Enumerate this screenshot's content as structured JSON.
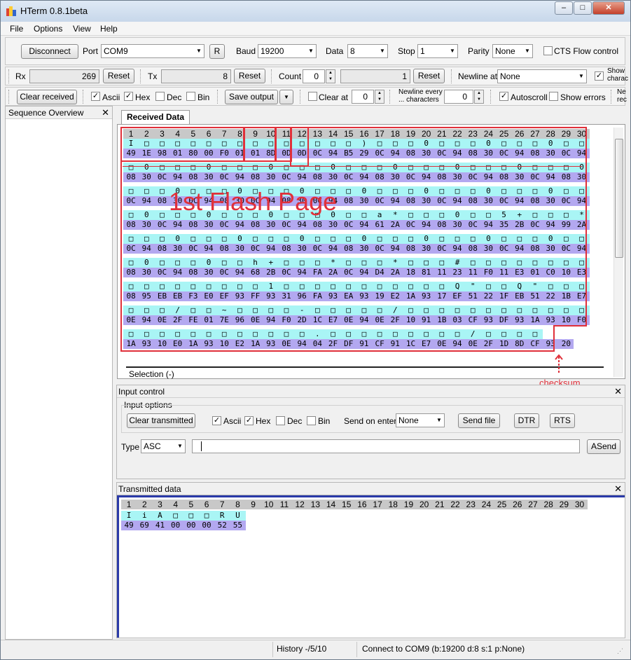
{
  "window": {
    "title": "HTerm 0.8.1beta",
    "min": "‒",
    "max": "□",
    "close": "✕"
  },
  "menu": [
    "File",
    "Options",
    "View",
    "Help"
  ],
  "conn": {
    "disconnect": "Disconnect",
    "port_label": "Port",
    "port": "COM9",
    "r_btn": "R",
    "baud_label": "Baud",
    "baud": "19200",
    "data_label": "Data",
    "data": "8",
    "stop_label": "Stop",
    "stop": "1",
    "parity_label": "Parity",
    "parity": "None",
    "cts": "CTS Flow control"
  },
  "counters": {
    "rx_label": "Rx",
    "rx": "269",
    "reset": "Reset",
    "tx_label": "Tx",
    "tx": "8",
    "count_label": "Count",
    "count": "0",
    "count_val": "1",
    "newline_label": "Newline at",
    "newline": "None",
    "show_ctrl": "Show\ncharac"
  },
  "opts": {
    "clear_received": "Clear received",
    "ascii": "Ascii",
    "hex": "Hex",
    "dec": "Dec",
    "bin": "Bin",
    "save_output": "Save output",
    "clear_at": "Clear at",
    "clear_at_val": "0",
    "newline_every": "Newline every\n... characters",
    "newline_every_val": "0",
    "autoscroll": "Autoscroll",
    "show_errors": "Show errors",
    "newline_rec": "Ne\nrec"
  },
  "sequence_overview": "Sequence Overview",
  "received_tab": "Received Data",
  "columns": [
    "1",
    "2",
    "3",
    "4",
    "5",
    "6",
    "7",
    "8",
    "9",
    "10",
    "11",
    "12",
    "13",
    "14",
    "15",
    "16",
    "17",
    "18",
    "19",
    "20",
    "21",
    "22",
    "23",
    "24",
    "25",
    "26",
    "27",
    "28",
    "29",
    "30"
  ],
  "rx_rows": [
    {
      "asc": [
        "I",
        "□",
        "□",
        "□",
        "□",
        "□",
        "□",
        "□",
        "□",
        "□",
        "□",
        "□",
        "□",
        "□",
        "□",
        ")",
        "□",
        "□",
        "□",
        "0",
        "□",
        "□",
        "□",
        "0",
        "□",
        "□",
        "□",
        "0",
        "□",
        "□"
      ],
      "hex": [
        "49",
        "1E",
        "98",
        "01",
        "80",
        "00",
        "F0",
        "01",
        "01",
        "8D",
        "0D",
        "0D",
        "0C",
        "94",
        "B5",
        "29",
        "0C",
        "94",
        "08",
        "30",
        "0C",
        "94",
        "08",
        "30",
        "0C",
        "94",
        "08",
        "30",
        "0C",
        "94"
      ]
    },
    {
      "asc": [
        "□",
        "0",
        "□",
        "□",
        "□",
        "0",
        "□",
        "□",
        "□",
        "0",
        "□",
        "□",
        "□",
        "0",
        "□",
        "□",
        "□",
        "0",
        "□",
        "□",
        "□",
        "0",
        "□",
        "□",
        "□",
        "0",
        "□",
        "□",
        "□",
        "0"
      ],
      "hex": [
        "08",
        "30",
        "0C",
        "94",
        "08",
        "30",
        "0C",
        "94",
        "08",
        "30",
        "0C",
        "94",
        "08",
        "30",
        "0C",
        "94",
        "08",
        "30",
        "0C",
        "94",
        "08",
        "30",
        "0C",
        "94",
        "08",
        "30",
        "0C",
        "94",
        "08",
        "30"
      ]
    },
    {
      "asc": [
        "□",
        "□",
        "□",
        "0",
        "□",
        "□",
        "□",
        "0",
        "□",
        "□",
        "□",
        "0",
        "□",
        "□",
        "□",
        "0",
        "□",
        "□",
        "□",
        "0",
        "□",
        "□",
        "□",
        "0",
        "□",
        "□",
        "□",
        "0",
        "□",
        "□"
      ],
      "hex": [
        "0C",
        "94",
        "08",
        "30",
        "0C",
        "94",
        "08",
        "30",
        "0C",
        "94",
        "08",
        "30",
        "0C",
        "94",
        "08",
        "30",
        "0C",
        "94",
        "08",
        "30",
        "0C",
        "94",
        "08",
        "30",
        "0C",
        "94",
        "08",
        "30",
        "0C",
        "94"
      ]
    },
    {
      "asc": [
        "□",
        "0",
        "□",
        "□",
        "□",
        "0",
        "□",
        "□",
        "□",
        "0",
        "□",
        "□",
        "□",
        "0",
        "□",
        "□",
        "a",
        "*",
        "□",
        "□",
        "□",
        "0",
        "□",
        "□",
        "5",
        "+",
        "□",
        "□",
        "□",
        "*"
      ],
      "hex": [
        "08",
        "30",
        "0C",
        "94",
        "08",
        "30",
        "0C",
        "94",
        "08",
        "30",
        "0C",
        "94",
        "08",
        "30",
        "0C",
        "94",
        "61",
        "2A",
        "0C",
        "94",
        "08",
        "30",
        "0C",
        "94",
        "35",
        "2B",
        "0C",
        "94",
        "99",
        "2A"
      ]
    },
    {
      "asc": [
        "□",
        "□",
        "□",
        "0",
        "□",
        "□",
        "□",
        "0",
        "□",
        "□",
        "□",
        "0",
        "□",
        "□",
        "□",
        "0",
        "□",
        "□",
        "□",
        "0",
        "□",
        "□",
        "□",
        "0",
        "□",
        "□",
        "□",
        "0",
        "□",
        "□"
      ],
      "hex": [
        "0C",
        "94",
        "08",
        "30",
        "0C",
        "94",
        "08",
        "30",
        "0C",
        "94",
        "08",
        "30",
        "0C",
        "94",
        "08",
        "30",
        "0C",
        "94",
        "08",
        "30",
        "0C",
        "94",
        "08",
        "30",
        "0C",
        "94",
        "08",
        "30",
        "0C",
        "94"
      ]
    },
    {
      "asc": [
        "□",
        "0",
        "□",
        "□",
        "□",
        "0",
        "□",
        "□",
        "h",
        "+",
        "□",
        "□",
        "□",
        "*",
        "□",
        "□",
        "□",
        "*",
        "□",
        "□",
        "□",
        "#",
        "□",
        "□",
        "□",
        "□",
        "□",
        "□",
        "□",
        "□"
      ],
      "hex": [
        "08",
        "30",
        "0C",
        "94",
        "08",
        "30",
        "0C",
        "94",
        "68",
        "2B",
        "0C",
        "94",
        "FA",
        "2A",
        "0C",
        "94",
        "D4",
        "2A",
        "18",
        "81",
        "11",
        "23",
        "11",
        "F0",
        "11",
        "E3",
        "01",
        "C0",
        "10",
        "E3"
      ]
    },
    {
      "asc": [
        "□",
        "□",
        "□",
        "□",
        "□",
        "□",
        "□",
        "□",
        "□",
        "1",
        "□",
        "□",
        "□",
        "□",
        "□",
        "□",
        "□",
        "□",
        "□",
        "□",
        "□",
        "Q",
        "\"",
        "□",
        "□",
        "Q",
        "\"",
        "□",
        "□",
        "□"
      ],
      "hex": [
        "08",
        "95",
        "EB",
        "EB",
        "F3",
        "E0",
        "EF",
        "93",
        "FF",
        "93",
        "31",
        "96",
        "FA",
        "93",
        "EA",
        "93",
        "19",
        "E2",
        "1A",
        "93",
        "17",
        "EF",
        "51",
        "22",
        "1F",
        "EB",
        "51",
        "22",
        "1B",
        "E7"
      ]
    },
    {
      "asc": [
        "□",
        "□",
        "□",
        "/",
        "□",
        "□",
        "~",
        "□",
        "□",
        "□",
        "□",
        "-",
        "□",
        "□",
        "□",
        "□",
        "□",
        "/",
        "□",
        "□",
        "□",
        "□",
        "□",
        "□",
        "□",
        "□",
        "□",
        "□",
        "□",
        "□"
      ],
      "hex": [
        "0E",
        "94",
        "0E",
        "2F",
        "FE",
        "01",
        "7E",
        "96",
        "0E",
        "94",
        "F0",
        "2D",
        "1C",
        "E7",
        "0E",
        "94",
        "0E",
        "2F",
        "10",
        "91",
        "1B",
        "03",
        "CF",
        "93",
        "DF",
        "93",
        "1A",
        "93",
        "10",
        "F0"
      ]
    },
    {
      "asc": [
        "□",
        "□",
        "□",
        "□",
        "□",
        "□",
        "□",
        "□",
        "□",
        "□",
        "□",
        "□",
        ".",
        "□",
        "□",
        "□",
        "□",
        "□",
        "□",
        "□",
        "□",
        "□",
        "/",
        "□",
        "□",
        "□",
        "□"
      ],
      "hex": [
        "1A",
        "93",
        "10",
        "E0",
        "1A",
        "93",
        "10",
        "E2",
        "1A",
        "93",
        "0E",
        "94",
        "04",
        "2F",
        "DF",
        "91",
        "CF",
        "91",
        "1C",
        "E7",
        "0E",
        "94",
        "0E",
        "2F",
        "1D",
        "8D",
        "CF",
        "93",
        "20"
      ]
    }
  ],
  "annotations": {
    "flash_page": "1st Flash Page",
    "checksum": "checksum"
  },
  "selection": "Selection (-)",
  "input_control": {
    "title": "Input control",
    "options_title": "Input options",
    "clear_transmitted": "Clear transmitted",
    "ascii": "Ascii",
    "hex": "Hex",
    "dec": "Dec",
    "bin": "Bin",
    "send_on_enter_label": "Send on enter",
    "send_on_enter": "None",
    "send_file": "Send file",
    "dtr": "DTR",
    "rts": "RTS",
    "type_label": "Type",
    "type": "ASC",
    "asend": "ASend"
  },
  "transmitted": {
    "title": "Transmitted data",
    "asc": [
      "I",
      "i",
      "A",
      "□",
      "□",
      "□",
      "R",
      "U"
    ],
    "hex": [
      "49",
      "69",
      "41",
      "00",
      "00",
      "00",
      "52",
      "55"
    ]
  },
  "status": {
    "history": "History -/5/10",
    "connect": "Connect to COM9 (b:19200 d:8 s:1 p:None)"
  },
  "colors": {
    "ascii_bg": "#a9f5f5",
    "hex_bg": "#b3a8f0",
    "annotation": "#e0303a"
  }
}
